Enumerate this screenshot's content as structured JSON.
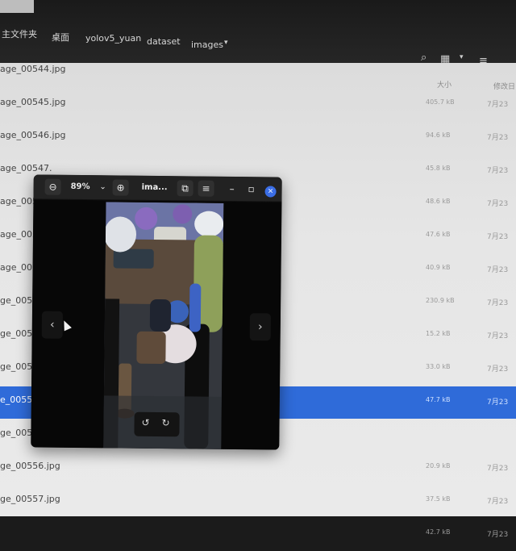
{
  "header": {
    "breadcrumbs": [
      "主文件夹",
      "桌面",
      "yolov5_yuan",
      "dataset",
      "images"
    ],
    "dropdown_caret": "▾"
  },
  "toolbar": {
    "search_icon": "⌕",
    "view_icon": "▦",
    "view_dropdown": "▾",
    "menu_icon": "≡"
  },
  "columns": {
    "size": "大小",
    "modified": "修改日"
  },
  "files": [
    {
      "name": "age_00544.jpg",
      "size": "",
      "date": ""
    },
    {
      "name": "age_00545.jpg",
      "size": "405.7 kB",
      "date": "7月23"
    },
    {
      "name": "age_00546.jpg",
      "size": "94.6 kB",
      "date": "7月23"
    },
    {
      "name": "age_00547.",
      "size": "45.8 kB",
      "date": "7月23"
    },
    {
      "name": "age_00548.",
      "size": "48.6 kB",
      "date": "7月23"
    },
    {
      "name": "age_00549.",
      "size": "47.6 kB",
      "date": "7月23"
    },
    {
      "name": "age_00550.",
      "size": "40.9 kB",
      "date": "7月23"
    },
    {
      "name": "ge_00551.",
      "size": "230.9 kB",
      "date": "7月23"
    },
    {
      "name": "ge_00552.",
      "size": "15.2 kB",
      "date": "7月23"
    },
    {
      "name": "ge_00553.",
      "size": "33.0 kB",
      "date": "7月23"
    },
    {
      "name": "e_00554.",
      "size": "47.7 kB",
      "date": "7月23"
    },
    {
      "name": "ge_00555.",
      "size": "",
      "date": ""
    },
    {
      "name": "ge_00556.jpg",
      "size": "20.9 kB",
      "date": "7月23"
    },
    {
      "name": "ge_00557.jpg",
      "size": "37.5 kB",
      "date": "7月23"
    },
    {
      "name": "",
      "size": "42.7 kB",
      "date": "7月23"
    }
  ],
  "selected_file_index": 10,
  "viewer": {
    "zoom_out_icon": "⊖",
    "zoom_level": "89%",
    "zoom_dropdown": "⌄",
    "zoom_in_icon": "⊕",
    "title": "ima...",
    "copy_icon": "⧉",
    "menu_icon": "≡",
    "minimize_icon": "–",
    "maximize_icon": "▫",
    "close_icon": "×",
    "prev_icon": "‹",
    "next_icon": "›",
    "rotate_left_icon": "↺",
    "rotate_right_icon": "↻"
  },
  "colors": {
    "selection": "#2f6bd9",
    "close_button": "#3b6ee6",
    "list_background": "#e6e6e6",
    "viewer_background": "#1c1c1c"
  }
}
